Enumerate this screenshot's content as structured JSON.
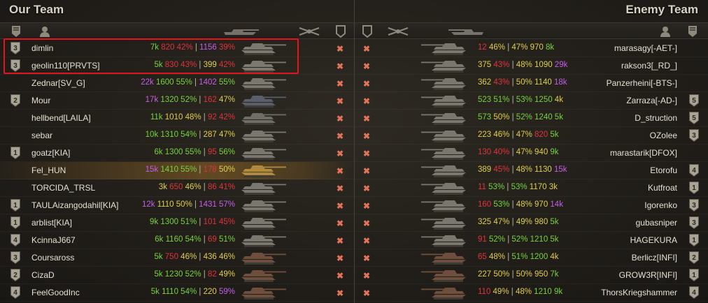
{
  "our_team": {
    "title": "Our Team",
    "players": [
      {
        "name": "dimlin",
        "badge": "3",
        "tank_color": "#7c7a70",
        "stats": [
          {
            "t": "7k",
            "c": "green"
          },
          {
            "t": " 820",
            "c": "red"
          },
          {
            "t": " 42%",
            "c": "red"
          },
          {
            "t": " | ",
            "c": "sep"
          },
          {
            "t": "1156",
            "c": "purple"
          },
          {
            "t": " 39%",
            "c": "red"
          }
        ]
      },
      {
        "name": "geolin110[PRVTS]",
        "badge": "3",
        "tank_color": "#7c7a70",
        "stats": [
          {
            "t": "5k",
            "c": "green"
          },
          {
            "t": " 830",
            "c": "red"
          },
          {
            "t": " 43%",
            "c": "red"
          },
          {
            "t": " | ",
            "c": "sep"
          },
          {
            "t": "399",
            "c": "yellow"
          },
          {
            "t": " 42%",
            "c": "red"
          }
        ]
      },
      {
        "name": "Zednar[SV_G]",
        "badge": "",
        "tank_color": "#7a786e",
        "stats": [
          {
            "t": "22k",
            "c": "purple"
          },
          {
            "t": " 1600",
            "c": "green"
          },
          {
            "t": " 55%",
            "c": "green"
          },
          {
            "t": " | ",
            "c": "sep"
          },
          {
            "t": "1402",
            "c": "purple"
          },
          {
            "t": " 55%",
            "c": "green"
          }
        ]
      },
      {
        "name": "Mour",
        "badge": "2",
        "tank_color": "#5a5e6a",
        "stats": [
          {
            "t": "17k",
            "c": "purple"
          },
          {
            "t": " 1320",
            "c": "green"
          },
          {
            "t": " 52%",
            "c": "green"
          },
          {
            "t": " | ",
            "c": "sep"
          },
          {
            "t": "162",
            "c": "red"
          },
          {
            "t": " 47%",
            "c": "yellow"
          }
        ]
      },
      {
        "name": "hellbend[LAILA]",
        "badge": "",
        "tank_color": "#6f6e66",
        "stats": [
          {
            "t": "11k",
            "c": "green"
          },
          {
            "t": " 1010",
            "c": "yellow"
          },
          {
            "t": " 48%",
            "c": "yellow"
          },
          {
            "t": " | ",
            "c": "sep"
          },
          {
            "t": "92",
            "c": "red"
          },
          {
            "t": " 42%",
            "c": "red"
          }
        ]
      },
      {
        "name": "sebar",
        "badge": "",
        "tank_color": "#7a786e",
        "stats": [
          {
            "t": "10k",
            "c": "green"
          },
          {
            "t": " 1310",
            "c": "green"
          },
          {
            "t": " 54%",
            "c": "green"
          },
          {
            "t": " | ",
            "c": "sep"
          },
          {
            "t": "287",
            "c": "yellow"
          },
          {
            "t": " 47%",
            "c": "yellow"
          }
        ]
      },
      {
        "name": "goatz[KIA]",
        "badge": "1",
        "tank_color": "#7a786e",
        "stats": [
          {
            "t": "6k",
            "c": "green"
          },
          {
            "t": " 1300",
            "c": "green"
          },
          {
            "t": " 55%",
            "c": "green"
          },
          {
            "t": " | ",
            "c": "sep"
          },
          {
            "t": "95",
            "c": "red"
          },
          {
            "t": " 56%",
            "c": "green"
          }
        ]
      },
      {
        "name": "Fel_HUN",
        "badge": "",
        "tank_color": "#b08a3c",
        "highlight": true,
        "stats": [
          {
            "t": "15k",
            "c": "purple"
          },
          {
            "t": " 1410",
            "c": "green"
          },
          {
            "t": " 55%",
            "c": "green"
          },
          {
            "t": " | ",
            "c": "sep"
          },
          {
            "t": "178",
            "c": "red"
          },
          {
            "t": " 50%",
            "c": "yellow"
          }
        ]
      },
      {
        "name": "TORCIDA_TRSL",
        "badge": "",
        "tank_color": "#7a786e",
        "stats": [
          {
            "t": "3k",
            "c": "yellow"
          },
          {
            "t": " 650",
            "c": "red"
          },
          {
            "t": " 46%",
            "c": "yellow"
          },
          {
            "t": " | ",
            "c": "sep"
          },
          {
            "t": "86",
            "c": "red"
          },
          {
            "t": " 41%",
            "c": "red"
          }
        ]
      },
      {
        "name": "TAULAizangodahil[KIA]",
        "badge": "1",
        "tank_color": "#7a786e",
        "stats": [
          {
            "t": "12k",
            "c": "purple"
          },
          {
            "t": " 1110",
            "c": "yellow"
          },
          {
            "t": " 50%",
            "c": "yellow"
          },
          {
            "t": " | ",
            "c": "sep"
          },
          {
            "t": "1431",
            "c": "purple"
          },
          {
            "t": " 57%",
            "c": "purple"
          }
        ]
      },
      {
        "name": "arblist[KIA]",
        "badge": "1",
        "tank_color": "#7a786e",
        "stats": [
          {
            "t": "9k",
            "c": "green"
          },
          {
            "t": " 1300",
            "c": "green"
          },
          {
            "t": " 51%",
            "c": "green"
          },
          {
            "t": " | ",
            "c": "sep"
          },
          {
            "t": "101",
            "c": "red"
          },
          {
            "t": " 45%",
            "c": "red"
          }
        ]
      },
      {
        "name": "KcinnaJ667",
        "badge": "4",
        "tank_color": "#7a786e",
        "stats": [
          {
            "t": "6k",
            "c": "green"
          },
          {
            "t": " 1160",
            "c": "green"
          },
          {
            "t": " 54%",
            "c": "green"
          },
          {
            "t": " | ",
            "c": "sep"
          },
          {
            "t": "69",
            "c": "red"
          },
          {
            "t": " 51%",
            "c": "green"
          }
        ]
      },
      {
        "name": "Coursaross",
        "badge": "3",
        "tank_color": "#6e4e3c",
        "stats": [
          {
            "t": "5k",
            "c": "green"
          },
          {
            "t": " 750",
            "c": "red"
          },
          {
            "t": " 46%",
            "c": "yellow"
          },
          {
            "t": " | ",
            "c": "sep"
          },
          {
            "t": "436",
            "c": "yellow"
          },
          {
            "t": " 46%",
            "c": "yellow"
          }
        ]
      },
      {
        "name": "CizaD",
        "badge": "2",
        "tank_color": "#6e4e3c",
        "stats": [
          {
            "t": "5k",
            "c": "green"
          },
          {
            "t": " 1230",
            "c": "green"
          },
          {
            "t": " 52%",
            "c": "green"
          },
          {
            "t": " | ",
            "c": "sep"
          },
          {
            "t": "82",
            "c": "red"
          },
          {
            "t": " 49%",
            "c": "yellow"
          }
        ]
      },
      {
        "name": "FeelGoodInc",
        "badge": "4",
        "tank_color": "#6e4e3c",
        "stats": [
          {
            "t": "5k",
            "c": "green"
          },
          {
            "t": " 1110",
            "c": "green"
          },
          {
            "t": " 54%",
            "c": "green"
          },
          {
            "t": " | ",
            "c": "sep"
          },
          {
            "t": "220",
            "c": "yellow"
          },
          {
            "t": " 59%",
            "c": "purple"
          }
        ]
      }
    ]
  },
  "enemy_team": {
    "title": "Enemy Team",
    "players": [
      {
        "name": "marasagy[-AET-]",
        "badge": "",
        "tank_color": "#7a786e",
        "stats": [
          {
            "t": "12",
            "c": "red"
          },
          {
            "t": " 46%",
            "c": "yellow"
          },
          {
            "t": " | ",
            "c": "sep"
          },
          {
            "t": "47%",
            "c": "yellow"
          },
          {
            "t": " 970",
            "c": "yellow"
          },
          {
            "t": " 8k",
            "c": "green"
          }
        ]
      },
      {
        "name": "rakson3[_RD_]",
        "badge": "",
        "tank_color": "#7a786e",
        "stats": [
          {
            "t": "375",
            "c": "yellow"
          },
          {
            "t": " 43%",
            "c": "red"
          },
          {
            "t": " | ",
            "c": "sep"
          },
          {
            "t": "48%",
            "c": "yellow"
          },
          {
            "t": " 1090",
            "c": "yellow"
          },
          {
            "t": " 29k",
            "c": "purple"
          }
        ]
      },
      {
        "name": "Panzerheini[-BTS-]",
        "badge": "",
        "tank_color": "#7a786e",
        "stats": [
          {
            "t": "362",
            "c": "yellow"
          },
          {
            "t": " 43%",
            "c": "red"
          },
          {
            "t": " | ",
            "c": "sep"
          },
          {
            "t": "50%",
            "c": "yellow"
          },
          {
            "t": " 1140",
            "c": "yellow"
          },
          {
            "t": " 18k",
            "c": "purple"
          }
        ]
      },
      {
        "name": "Zarraza[-AD-]",
        "badge": "5",
        "tank_color": "#7a786e",
        "stats": [
          {
            "t": "523",
            "c": "green"
          },
          {
            "t": " 51%",
            "c": "green"
          },
          {
            "t": " | ",
            "c": "sep"
          },
          {
            "t": "53%",
            "c": "green"
          },
          {
            "t": " 1250",
            "c": "green"
          },
          {
            "t": " 4k",
            "c": "yellow"
          }
        ]
      },
      {
        "name": "D_struction",
        "badge": "5",
        "tank_color": "#7a786e",
        "stats": [
          {
            "t": "573",
            "c": "green"
          },
          {
            "t": " 50%",
            "c": "yellow"
          },
          {
            "t": " | ",
            "c": "sep"
          },
          {
            "t": "52%",
            "c": "green"
          },
          {
            "t": " 1240",
            "c": "green"
          },
          {
            "t": " 5k",
            "c": "green"
          }
        ]
      },
      {
        "name": "OZolee",
        "badge": "3",
        "tank_color": "#7a786e",
        "stats": [
          {
            "t": "223",
            "c": "yellow"
          },
          {
            "t": " 46%",
            "c": "yellow"
          },
          {
            "t": " | ",
            "c": "sep"
          },
          {
            "t": "47%",
            "c": "yellow"
          },
          {
            "t": " 820",
            "c": "red"
          },
          {
            "t": " 5k",
            "c": "green"
          }
        ]
      },
      {
        "name": "marastarik[DFOX]",
        "badge": "",
        "tank_color": "#7a786e",
        "stats": [
          {
            "t": "130",
            "c": "red"
          },
          {
            "t": " 40%",
            "c": "red"
          },
          {
            "t": " | ",
            "c": "sep"
          },
          {
            "t": "47%",
            "c": "yellow"
          },
          {
            "t": " 940",
            "c": "yellow"
          },
          {
            "t": " 9k",
            "c": "green"
          }
        ]
      },
      {
        "name": "Etorofu",
        "badge": "4",
        "tank_color": "#7a786e",
        "stats": [
          {
            "t": "389",
            "c": "yellow"
          },
          {
            "t": " 45%",
            "c": "red"
          },
          {
            "t": " | ",
            "c": "sep"
          },
          {
            "t": "48%",
            "c": "yellow"
          },
          {
            "t": " 1130",
            "c": "yellow"
          },
          {
            "t": " 15k",
            "c": "purple"
          }
        ]
      },
      {
        "name": "Kutfroat",
        "badge": "1",
        "tank_color": "#7a786e",
        "stats": [
          {
            "t": "11",
            "c": "red"
          },
          {
            "t": " 53%",
            "c": "green"
          },
          {
            "t": " | ",
            "c": "sep"
          },
          {
            "t": "53%",
            "c": "green"
          },
          {
            "t": " 1170",
            "c": "yellow"
          },
          {
            "t": " 3k",
            "c": "yellow"
          }
        ]
      },
      {
        "name": "Igorenko",
        "badge": "3",
        "tank_color": "#7a786e",
        "stats": [
          {
            "t": "160",
            "c": "red"
          },
          {
            "t": " 53%",
            "c": "green"
          },
          {
            "t": " | ",
            "c": "sep"
          },
          {
            "t": "48%",
            "c": "yellow"
          },
          {
            "t": " 970",
            "c": "yellow"
          },
          {
            "t": " 14k",
            "c": "purple"
          }
        ]
      },
      {
        "name": "gubasniper",
        "badge": "3",
        "tank_color": "#7a786e",
        "stats": [
          {
            "t": "325",
            "c": "yellow"
          },
          {
            "t": " 47%",
            "c": "yellow"
          },
          {
            "t": " | ",
            "c": "sep"
          },
          {
            "t": "49%",
            "c": "yellow"
          },
          {
            "t": " 980",
            "c": "yellow"
          },
          {
            "t": " 5k",
            "c": "green"
          }
        ]
      },
      {
        "name": "HAGEKURA",
        "badge": "1",
        "tank_color": "#7a786e",
        "stats": [
          {
            "t": "91",
            "c": "red"
          },
          {
            "t": " 52%",
            "c": "green"
          },
          {
            "t": " | ",
            "c": "sep"
          },
          {
            "t": "52%",
            "c": "green"
          },
          {
            "t": " 1210",
            "c": "green"
          },
          {
            "t": " 5k",
            "c": "green"
          }
        ]
      },
      {
        "name": "Berlicz[INFI]",
        "badge": "2",
        "tank_color": "#6e4e3c",
        "stats": [
          {
            "t": "65",
            "c": "red"
          },
          {
            "t": " 48%",
            "c": "yellow"
          },
          {
            "t": " | ",
            "c": "sep"
          },
          {
            "t": "51%",
            "c": "green"
          },
          {
            "t": " 1200",
            "c": "green"
          },
          {
            "t": " 4k",
            "c": "yellow"
          }
        ]
      },
      {
        "name": "GROW3R[INFI]",
        "badge": "1",
        "tank_color": "#6e4e3c",
        "stats": [
          {
            "t": "227",
            "c": "yellow"
          },
          {
            "t": " 50%",
            "c": "yellow"
          },
          {
            "t": " | ",
            "c": "sep"
          },
          {
            "t": "50%",
            "c": "yellow"
          },
          {
            "t": " 950",
            "c": "yellow"
          },
          {
            "t": " 7k",
            "c": "green"
          }
        ]
      },
      {
        "name": "ThorsKriegshammer",
        "badge": "4",
        "tank_color": "#6e4e3c",
        "stats": [
          {
            "t": "110",
            "c": "red"
          },
          {
            "t": " 49%",
            "c": "yellow"
          },
          {
            "t": " | ",
            "c": "sep"
          },
          {
            "t": "48%",
            "c": "yellow"
          },
          {
            "t": " 1210",
            "c": "green"
          },
          {
            "t": " 9k",
            "c": "green"
          }
        ]
      }
    ]
  },
  "status_marker": "✖"
}
